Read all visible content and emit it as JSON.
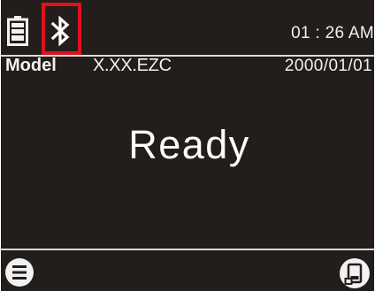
{
  "status_bar": {
    "battery_icon": "battery-icon",
    "bluetooth_icon": "bluetooth-icon",
    "highlight_color": "#e01020",
    "time": "01 : 26 AM"
  },
  "info": {
    "model_label": "Model",
    "model_value": "X.XX.EZC",
    "date": "2000/01/01"
  },
  "main": {
    "status": "Ready"
  },
  "footer": {
    "menu_icon": "menu-icon",
    "device_icon": "device-icon"
  },
  "colors": {
    "background": "#231e1b",
    "text": "#f2f2f2"
  }
}
